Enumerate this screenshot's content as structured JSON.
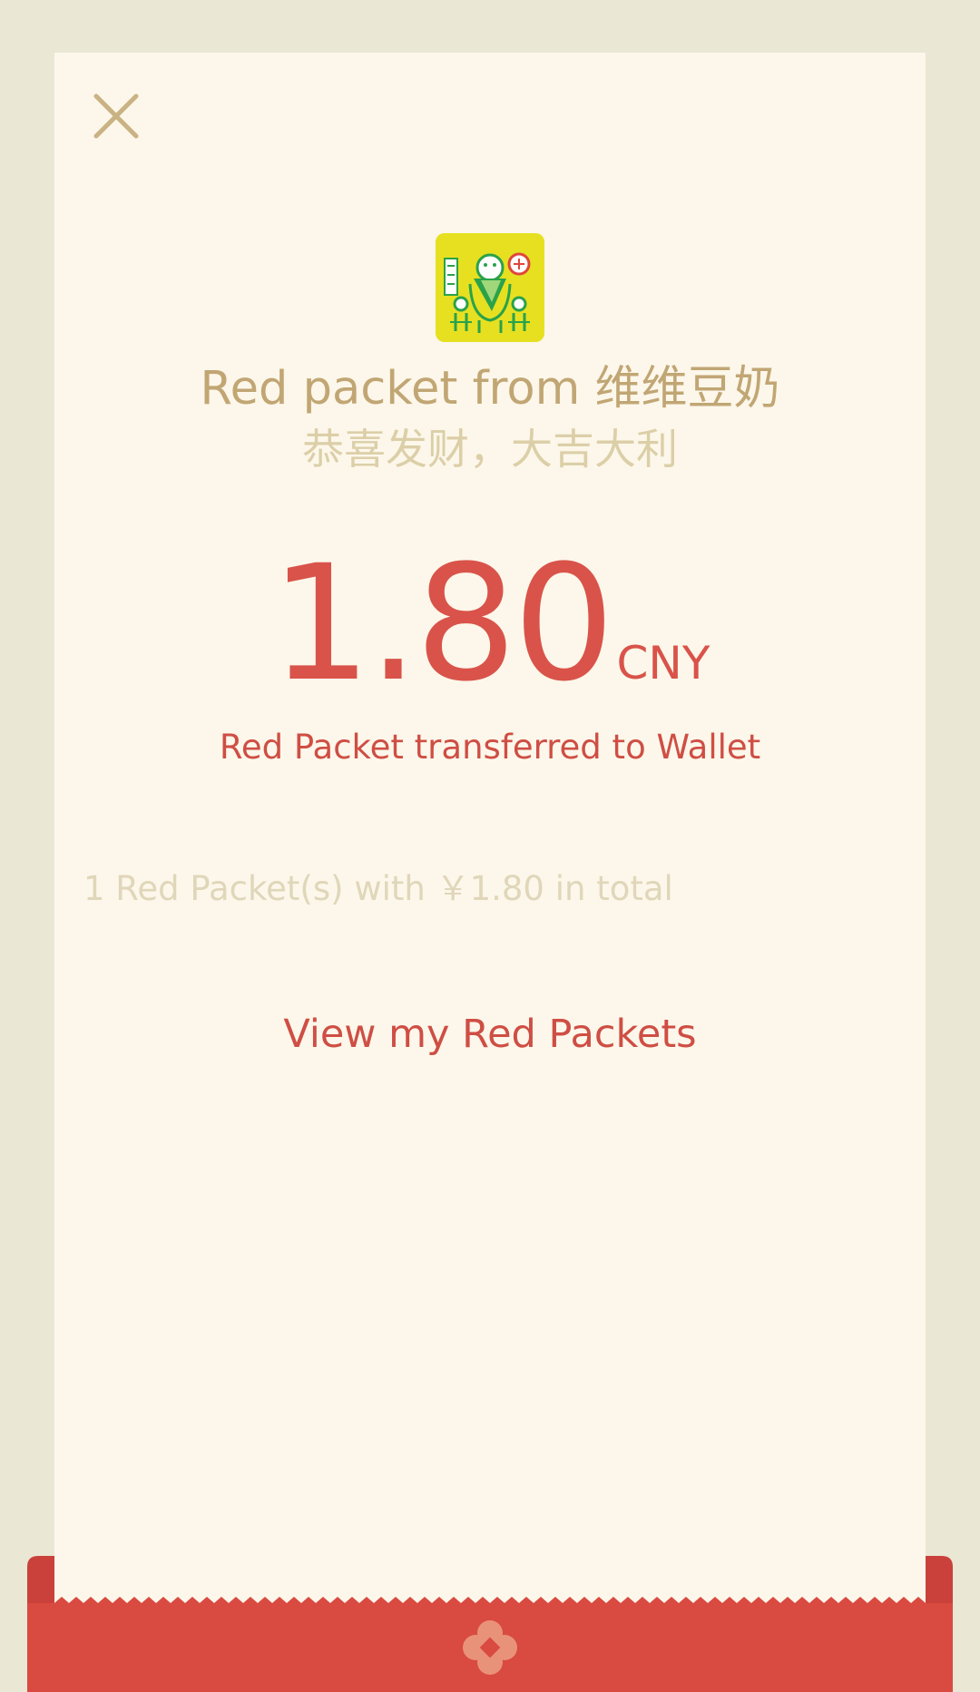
{
  "dialog": {
    "close_icon": "close-icon",
    "sender_avatar_icon": "sender-avatar-icon",
    "sender_title": "Red packet from 维维豆奶",
    "blessing": "恭喜发财，大吉大利",
    "amount": "1.80",
    "currency": "CNY",
    "transfer_status": "Red Packet transferred to Wallet",
    "summary": "1 Red Packet(s) with ￥1.80 in total",
    "view_link": "View my Red Packets",
    "envelope_emblem_icon": "flower-emblem-icon"
  },
  "colors": {
    "page_background": "#ebe7d5",
    "card_background": "#fcf7ea",
    "gold_text": "#c1a674",
    "light_gold_text": "#dccfa8",
    "red_accent": "#d9534a",
    "envelope_red": "#d94a41",
    "avatar_yellow": "#e6e021"
  }
}
